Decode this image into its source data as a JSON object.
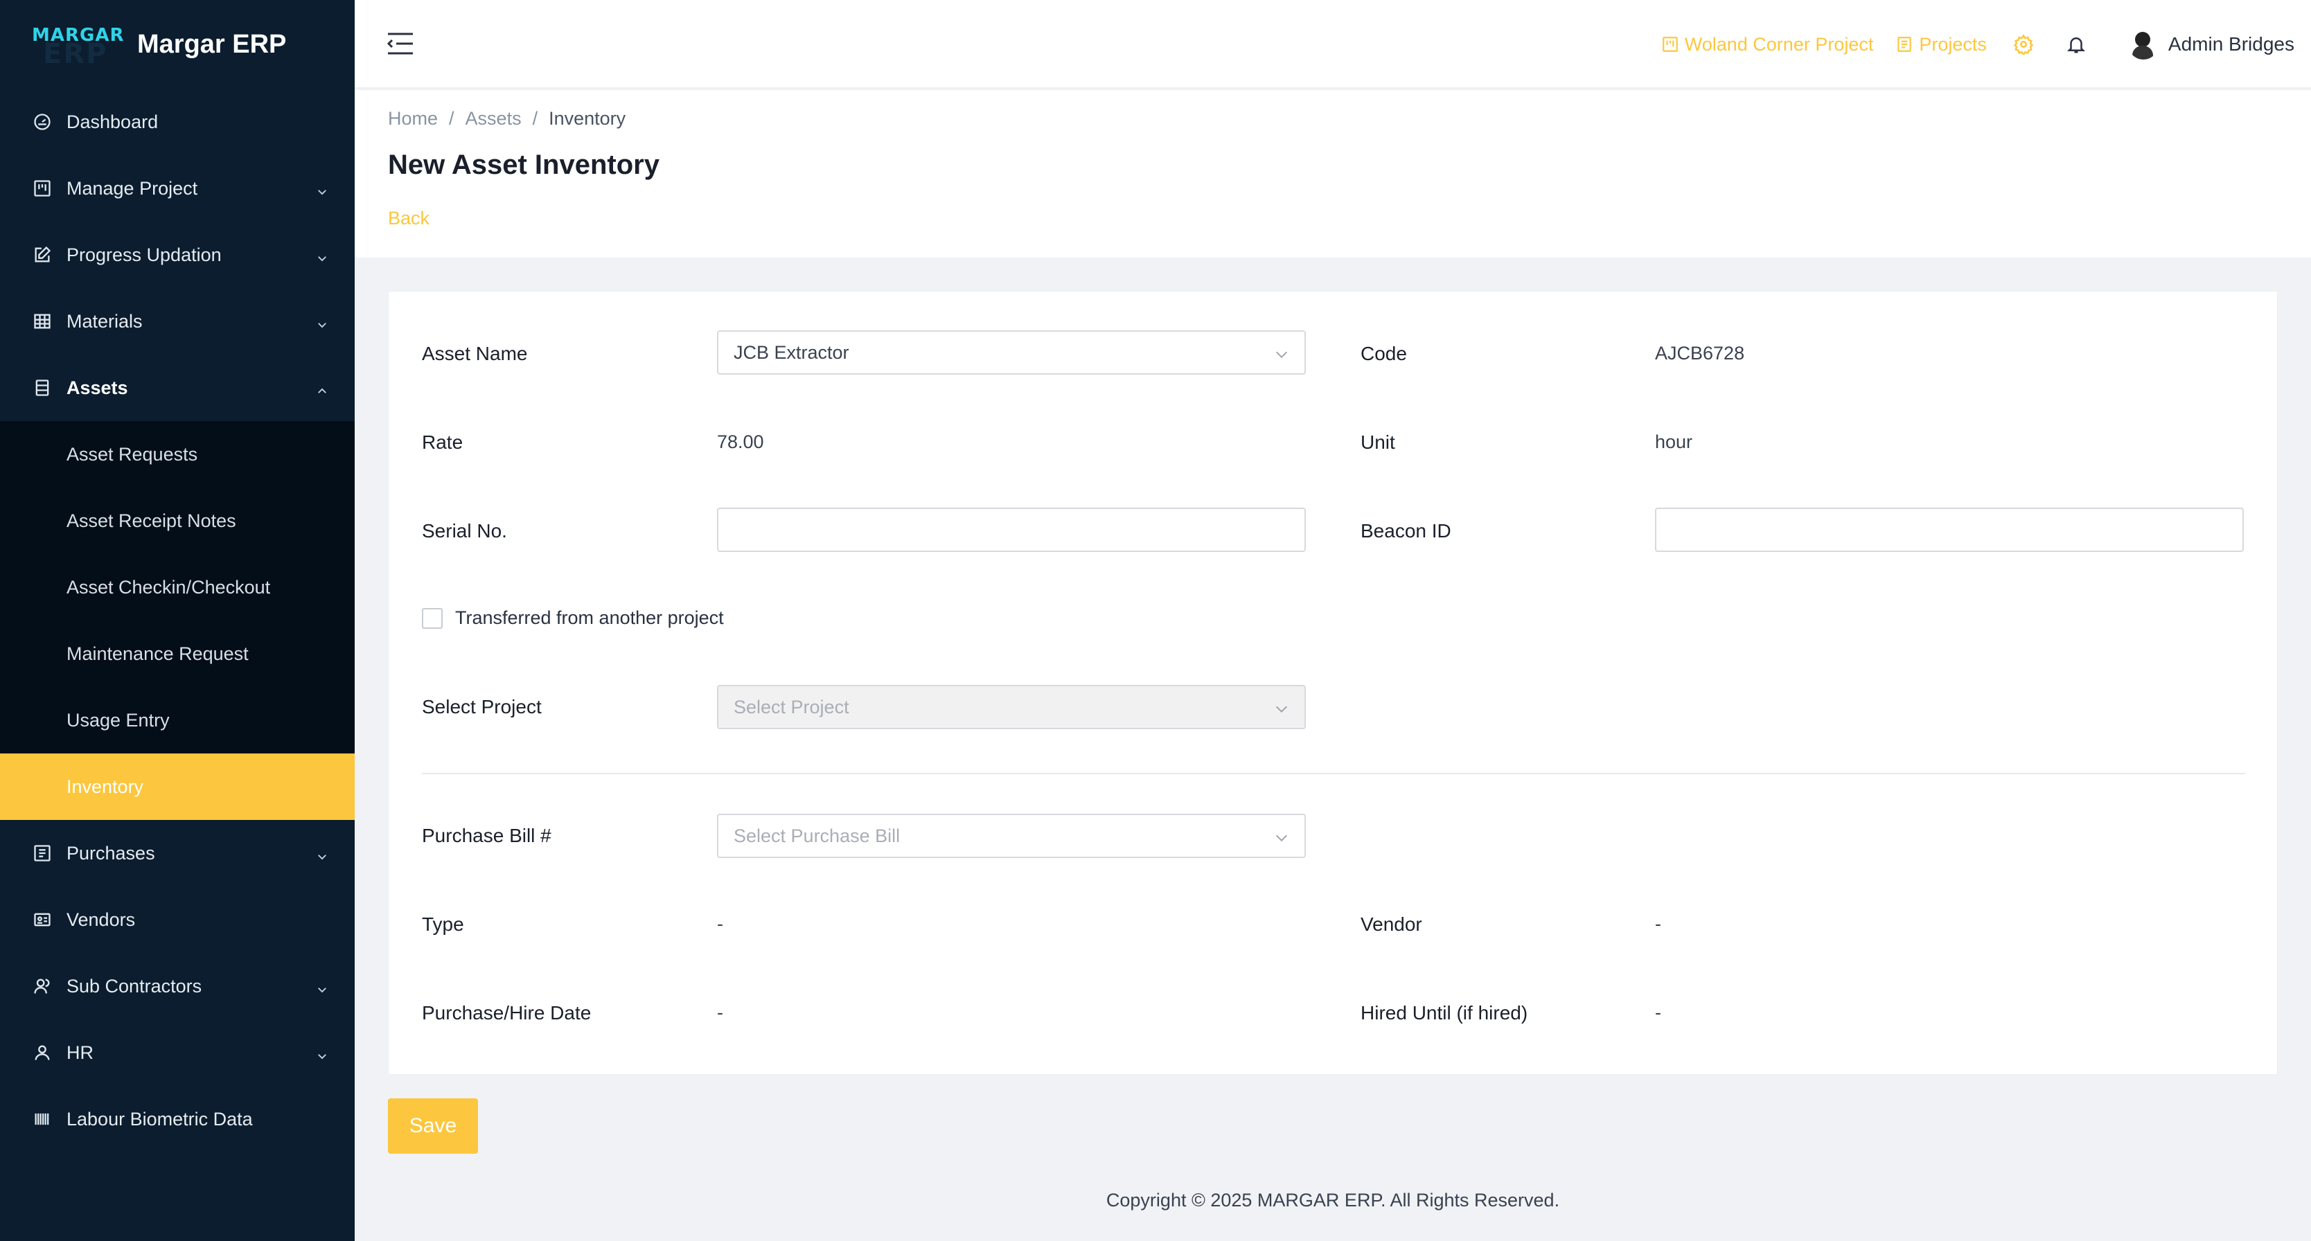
{
  "brand": {
    "logo_top": "MARGAR",
    "logo_bottom": "ERP",
    "name": "Margar ERP"
  },
  "sidebar": {
    "items": [
      {
        "label": "Dashboard",
        "icon": "dashboard-icon"
      },
      {
        "label": "Manage Project",
        "icon": "board-icon"
      },
      {
        "label": "Progress Updation",
        "icon": "edit-icon"
      },
      {
        "label": "Materials",
        "icon": "grid-icon"
      },
      {
        "label": "Assets",
        "icon": "assets-icon"
      },
      {
        "label": "Purchases",
        "icon": "purchases-icon"
      },
      {
        "label": "Vendors",
        "icon": "vendor-card-icon"
      },
      {
        "label": "Sub Contractors",
        "icon": "users-icon"
      },
      {
        "label": "HR",
        "icon": "user-icon"
      },
      {
        "label": "Labour Biometric Data",
        "icon": "barcode-icon"
      }
    ],
    "assets_sub": [
      {
        "label": "Asset Requests"
      },
      {
        "label": "Asset Receipt Notes"
      },
      {
        "label": "Asset Checkin/Checkout"
      },
      {
        "label": "Maintenance Request"
      },
      {
        "label": "Usage Entry"
      },
      {
        "label": "Inventory"
      }
    ]
  },
  "topbar": {
    "project_link": "Woland Corner Project",
    "projects_link": "Projects",
    "user_name": "Admin Bridges"
  },
  "breadcrumb": {
    "home": "Home",
    "section": "Assets",
    "current": "Inventory"
  },
  "page": {
    "title": "New Asset Inventory",
    "back": "Back"
  },
  "form": {
    "asset_name_label": "Asset Name",
    "asset_name_value": "JCB Extractor",
    "code_label": "Code",
    "code_value": "AJCB6728",
    "rate_label": "Rate",
    "rate_value": "78.00",
    "unit_label": "Unit",
    "unit_value": "hour",
    "serial_label": "Serial No.",
    "serial_value": "",
    "beacon_label": "Beacon ID",
    "beacon_value": "",
    "transferred_label": "Transferred from another project",
    "select_project_label": "Select Project",
    "select_project_placeholder": "Select Project",
    "purchase_bill_label": "Purchase Bill #",
    "purchase_bill_placeholder": "Select Purchase Bill",
    "type_label": "Type",
    "type_value": "-",
    "vendor_label": "Vendor",
    "vendor_value": "-",
    "purchase_date_label": "Purchase/Hire Date",
    "purchase_date_value": "-",
    "hired_until_label": "Hired Until (if hired)",
    "hired_until_value": "-"
  },
  "actions": {
    "save": "Save"
  },
  "footer": {
    "copyright": "Copyright © 2025 MARGAR ERP. All Rights Reserved."
  },
  "colors": {
    "accent": "#fcc73e",
    "sidebar_bg": "#0b1d2e",
    "submenu_bg": "#030e18"
  }
}
